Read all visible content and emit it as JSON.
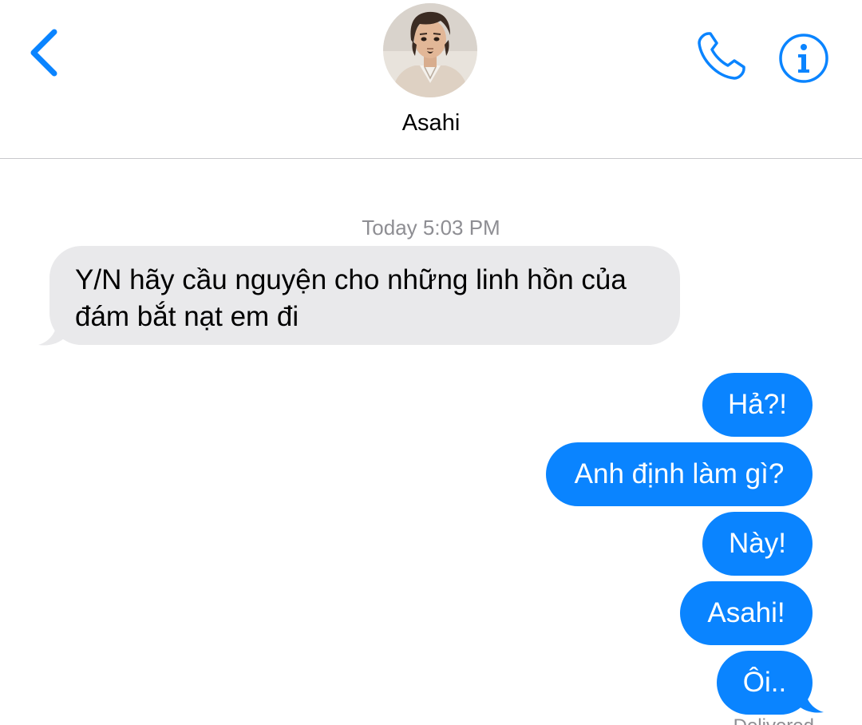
{
  "header": {
    "contact_name": "Asahi",
    "back_icon": "chevron-left-icon",
    "call_icon": "phone-icon",
    "info_icon": "info-icon",
    "accent_color": "#0a84ff"
  },
  "thread": {
    "timestamp": "Today 5:03 PM",
    "received": [
      {
        "line1": "Y/N hãy cầu nguyện cho những linh hồn của",
        "line2": "đám bắt nạt em đi"
      }
    ],
    "sent": [
      {
        "text": "Hả?!"
      },
      {
        "text": "Anh định làm gì?"
      },
      {
        "text": "Này!"
      },
      {
        "text": "Asahi!"
      },
      {
        "text": "Ôi.."
      }
    ],
    "delivered_label": "Delivered"
  },
  "colors": {
    "received_bubble": "#e9e9eb",
    "sent_bubble": "#0a84ff",
    "meta_text": "#8e8e93"
  }
}
